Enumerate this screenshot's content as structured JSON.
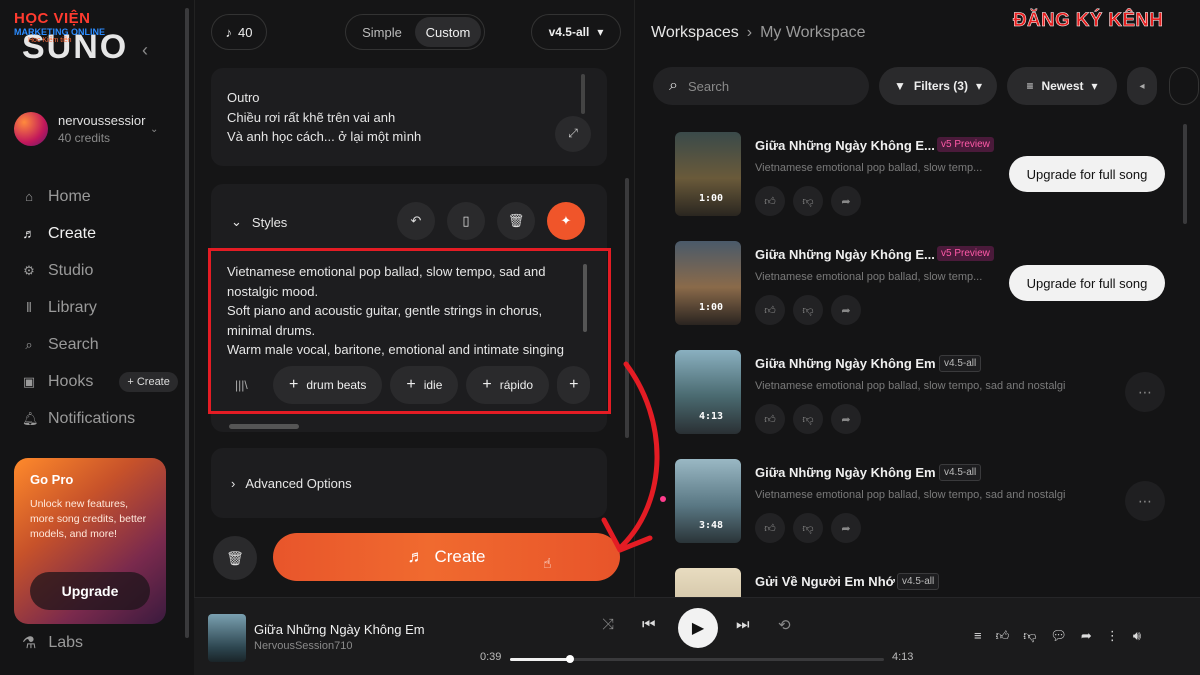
{
  "watermark": {
    "line1": "HỌC VIỆN",
    "line2": "MARKETING ONLINE",
    "line3": "Hoc Kiếm tiền"
  },
  "subscribe_banner": "ĐĂNG KÝ KÊNH",
  "sidebar": {
    "logo": "SUNO",
    "user": {
      "name": "nervoussessior",
      "credits": "40 credits"
    },
    "nav": [
      {
        "label": "Home",
        "icon": "home-icon"
      },
      {
        "label": "Create",
        "icon": "music-note-icon"
      },
      {
        "label": "Studio",
        "icon": "studio-icon"
      },
      {
        "label": "Library",
        "icon": "library-icon"
      },
      {
        "label": "Search",
        "icon": "search-icon"
      },
      {
        "label": "Hooks",
        "icon": "hooks-icon"
      },
      {
        "label": "Notifications",
        "icon": "bell-icon"
      }
    ],
    "hooks_create": "+ Create",
    "gopro": {
      "title": "Go Pro",
      "desc": "Unlock new features, more song credits, better models, and more!",
      "button": "Upgrade"
    },
    "labs": "Labs"
  },
  "create_panel": {
    "credit_count": "40",
    "modes": [
      "Simple",
      "Custom"
    ],
    "version": "v4.5-all",
    "lyrics": [
      "Outro",
      "Chiều rơi rất khẽ trên vai anh",
      "Và anh học cách... ở lại một mình"
    ],
    "styles_label": "Styles",
    "styles_text": [
      "Vietnamese emotional pop ballad, slow tempo, sad and",
      "nostalgic mood.",
      "Soft piano and acoustic guitar, gentle strings in chorus,",
      "minimal drums.",
      "Warm male vocal, baritone, emotional and intimate singing"
    ],
    "chips": [
      "drum beats",
      "idie",
      "rápido"
    ],
    "advanced": "Advanced Options",
    "create_button": "Create"
  },
  "workspace": {
    "breadcrumb": [
      "Workspaces",
      "My Workspace"
    ],
    "search_placeholder": "Search",
    "filters": "Filters (3)",
    "sort": "Newest",
    "upgrade_full": "Upgrade for full song",
    "songs": [
      {
        "title": "Giữa Những Ngày Không E...",
        "badge": "v5 Preview",
        "desc": "Vietnamese emotional pop ballad, slow temp...",
        "duration": "1:00"
      },
      {
        "title": "Giữa Những Ngày Không E...",
        "badge": "v5 Preview",
        "desc": "Vietnamese emotional pop ballad, slow temp...",
        "duration": "1:00"
      },
      {
        "title": "Giữa Những Ngày Không Em",
        "badge": "v4.5-all",
        "desc": "Vietnamese emotional pop ballad, slow tempo, sad and nostalgic ...",
        "duration": "4:13"
      },
      {
        "title": "Giữa Những Ngày Không Em",
        "badge": "v4.5-all",
        "desc": "Vietnamese emotional pop ballad, slow tempo, sad and nostalgic ...",
        "duration": "3:48"
      },
      {
        "title": "Gửi Về Người Em Nhớ",
        "badge": "v4.5-all",
        "desc": "",
        "duration": ""
      }
    ]
  },
  "player": {
    "title": "Giữa Những Ngày Không Em",
    "artist": "NervousSession710",
    "current": "0:39",
    "total": "4:13",
    "progress": 0.16
  }
}
